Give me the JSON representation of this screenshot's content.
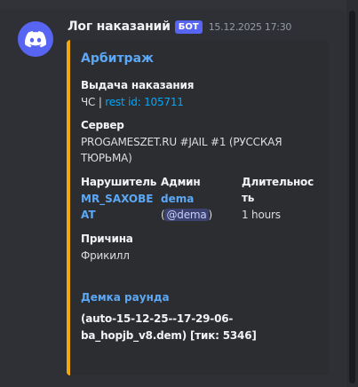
{
  "message": {
    "author": "Лог наказаний",
    "bot_tag": "БОТ",
    "timestamp": "15.12.2025 17:30",
    "avatar_icon": "discord-logo-icon"
  },
  "embed": {
    "accent_color": "#f0a80c",
    "title": "Арбитраж",
    "fields": {
      "issue": {
        "name": "Выдача наказания",
        "value_prefix": "ЧС | ",
        "value_link": "rest id: 105711"
      },
      "server": {
        "name": "Сервер",
        "value_line1": "PROGAMESZET.RU #JAIL #1 (РУССКАЯ",
        "value_line2": "ТЮРЬМА)"
      },
      "violator": {
        "name": "Нарушитель",
        "value_line1": "MR_SAXOBE",
        "value_line2": "AT"
      },
      "admin": {
        "name": "Админ",
        "value": "dema",
        "mention_open": "(",
        "mention": "@dema",
        "mention_close": ")"
      },
      "duration": {
        "name_line1": "Длительнос",
        "name_line2": "ть",
        "value": "1 hours"
      },
      "reason": {
        "name": "Причина",
        "value": "Фрикилл"
      },
      "demo": {
        "name": "Демка раунда",
        "value_line1": "(auto-15-12-25--17-29-06-",
        "value_line2": "ba_hopjb_v8.dem) [тик: 5346]"
      }
    }
  }
}
